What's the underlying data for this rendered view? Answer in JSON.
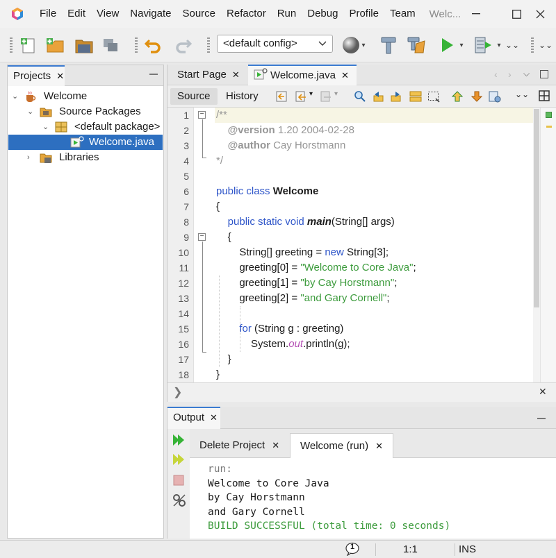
{
  "window": {
    "title": "Welc...",
    "colors": {
      "selection": "#2d6fc0",
      "keyword": "#2f56c9",
      "string": "#3c9b3c",
      "comment": "#969696",
      "field": "#b44fb4"
    }
  },
  "menu": [
    "File",
    "Edit",
    "View",
    "Navigate",
    "Source",
    "Refactor",
    "Run",
    "Debug",
    "Profile",
    "Team"
  ],
  "toolbar": {
    "config_value": "<default config>"
  },
  "projects": {
    "tab_label": "Projects",
    "tree": [
      {
        "label": "Welcome",
        "icon": "coffee-cup-icon"
      },
      {
        "label": "Source Packages",
        "icon": "folder-icon"
      },
      {
        "label": "<default package>",
        "icon": "package-icon"
      },
      {
        "label": "Welcome.java",
        "icon": "java-file-icon",
        "selected": true
      },
      {
        "label": "Libraries",
        "icon": "library-icon"
      }
    ]
  },
  "editor": {
    "tabs": [
      {
        "label": "Start Page"
      },
      {
        "label": "Welcome.java",
        "active": true
      }
    ],
    "source_tab": "Source",
    "history_tab": "History",
    "line_numbers": [
      "1",
      "2",
      "3",
      "4",
      "5",
      "6",
      "7",
      "8",
      "9",
      "10",
      "11",
      "12",
      "13",
      "14",
      "15",
      "16",
      "17",
      "18"
    ],
    "code": {
      "l1": "/**",
      "l2_tag": "@version",
      "l2_text": " 1.20 2004-02-28",
      "l3_tag": "@author",
      "l3_text": " Cay Horstmann",
      "l4": "*/",
      "l6_kw": "public class ",
      "l6_name": "Welcome",
      "l7": "{",
      "l8_kw": "public static void ",
      "l8_name": "main",
      "l8_rest": "(String[] args)",
      "l9": "{",
      "l10_a": "String[] greeting = ",
      "l10_kw": "new",
      "l10_b": " String[3];",
      "l11_a": "greeting[0] = ",
      "l11_str": "\"Welcome to Core Java\"",
      "l11_b": ";",
      "l12_a": "greeting[1] = ",
      "l12_str": "\"by Cay Horstmann\"",
      "l12_b": ";",
      "l13_a": "greeting[2] = ",
      "l13_str": "\"and Gary Cornell\"",
      "l13_b": ";",
      "l15_kw": "for",
      "l15_rest": " (String g : greeting)",
      "l16_a": "System.",
      "l16_fld": "out",
      "l16_b": ".println(g);",
      "l17": "}",
      "l18": "}"
    }
  },
  "output": {
    "tab_label": "Output",
    "subtabs": [
      {
        "label": "Delete Project"
      },
      {
        "label": "Welcome (run)",
        "active": true
      }
    ],
    "lines": {
      "run": "run:",
      "l1": "Welcome to Core Java",
      "l2": "by Cay Horstmann",
      "l3": "and Gary Cornell",
      "build": "BUILD SUCCESSFUL (total time: 0 seconds)"
    }
  },
  "status": {
    "notifications": "1",
    "position": "1:1",
    "mode": "INS"
  }
}
